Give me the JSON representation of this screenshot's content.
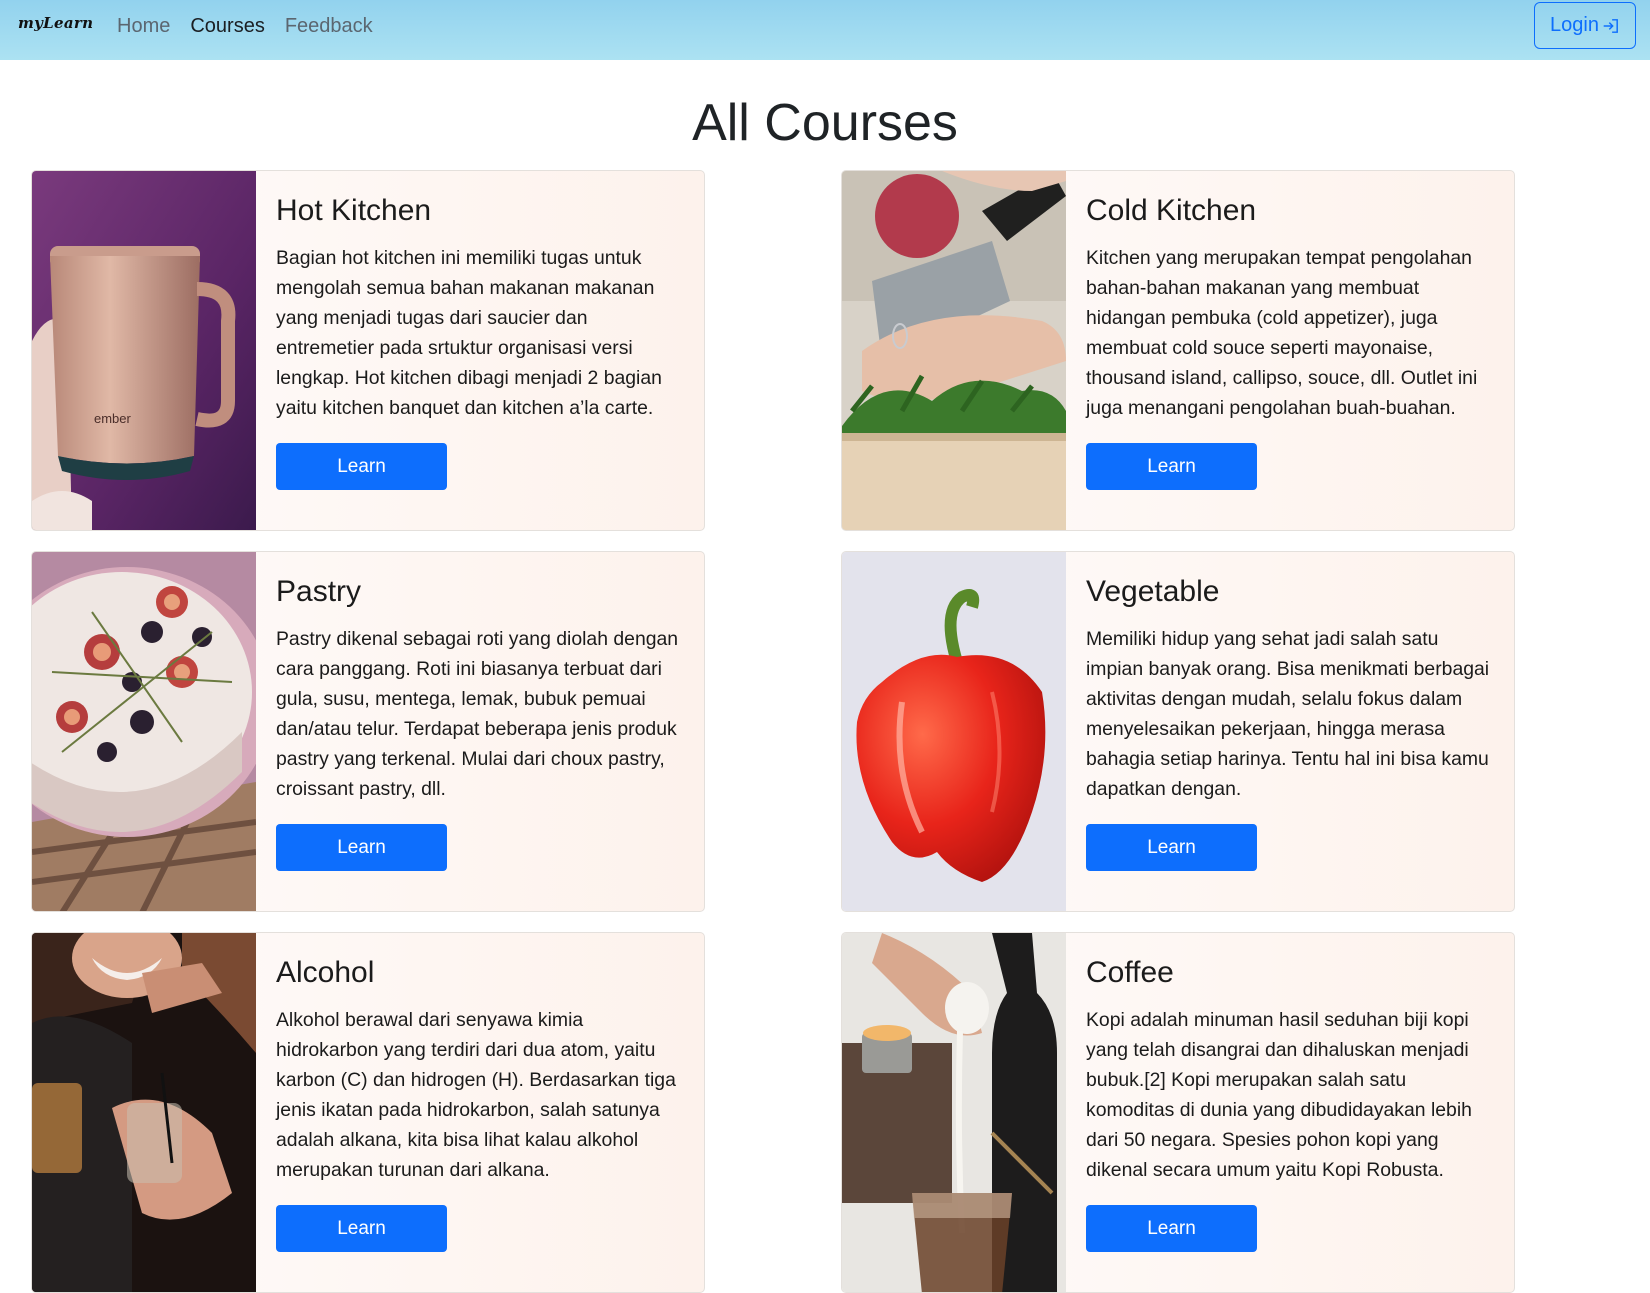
{
  "navbar": {
    "brand": "myLearn",
    "links": [
      "Home",
      "Courses",
      "Feedback"
    ],
    "active": "Courses",
    "login_label": "Login"
  },
  "page": {
    "title": "All Courses"
  },
  "courses": [
    {
      "title": "Hot Kitchen",
      "text": "Bagian hot kitchen ini memiliki tugas untuk mengolah semua bahan makanan makanan yang menjadi tugas dari saucier dan entremetier pada srtuktur organisasi versi lengkap. Hot kitchen dibagi menjadi 2 bagian yaitu kitchen banquet dan kitchen a’la carte.",
      "button": "Learn",
      "image": "copper-mug-photo",
      "image_text": "ember"
    },
    {
      "title": "Cold Kitchen",
      "text": "Kitchen yang merupakan tempat pengolahan bahan-bahan makanan yang membuat hidangan pembuka (cold appetizer), juga membuat cold souce seperti mayonaise, thousand island, callipso, souce, dll. Outlet ini juga menangani pengolahan buah-buahan.",
      "button": "Learn",
      "image": "chopping-herbs-photo"
    },
    {
      "title": "Pastry",
      "text": "Pastry dikenal sebagai roti yang diolah dengan cara panggang. Roti ini biasanya terbuat dari gula, susu, mentega, lemak, bubuk pemuai dan/atau telur. Terdapat beberapa jenis produk pastry yang terkenal. Mulai dari choux pastry, croissant pastry, dll.",
      "button": "Learn",
      "image": "fig-cake-photo"
    },
    {
      "title": "Vegetable",
      "text": "Memiliki hidup yang sehat jadi salah satu impian banyak orang. Bisa menikmati berbagai aktivitas dengan mudah, selalu fokus dalam menyelesaikan pekerjaan, hingga merasa bahagia setiap harinya. Tentu hal ini bisa kamu dapatkan dengan.",
      "button": "Learn",
      "image": "red-pepper-photo"
    },
    {
      "title": "Alcohol",
      "text": "Alkohol berawal dari senyawa kimia hidrokarbon yang terdiri dari dua atom, yaitu karbon (C) dan hidrogen (H). Berdasarkan tiga jenis ikatan pada hidrokarbon, salah satunya adalah alkana, kita bisa lihat kalau alkohol merupakan turunan dari alkana.",
      "button": "Learn",
      "image": "people-drinks-photo"
    },
    {
      "title": "Coffee",
      "text": "Kopi adalah minuman hasil seduhan biji kopi yang telah disangrai dan dihaluskan menjadi bubuk.[2] Kopi merupakan salah satu komoditas di dunia yang dibudidayakan lebih dari 50 negara. Spesies pohon kopi yang dikenal secara umum yaitu Kopi Robusta.",
      "button": "Learn",
      "image": "milk-pour-photo"
    }
  ],
  "colors": {
    "navbar_gradient": [
      "#92d2ee",
      "#ace2f2"
    ],
    "primary": "#0d6efd",
    "card_bg": "#fdf2ec"
  }
}
